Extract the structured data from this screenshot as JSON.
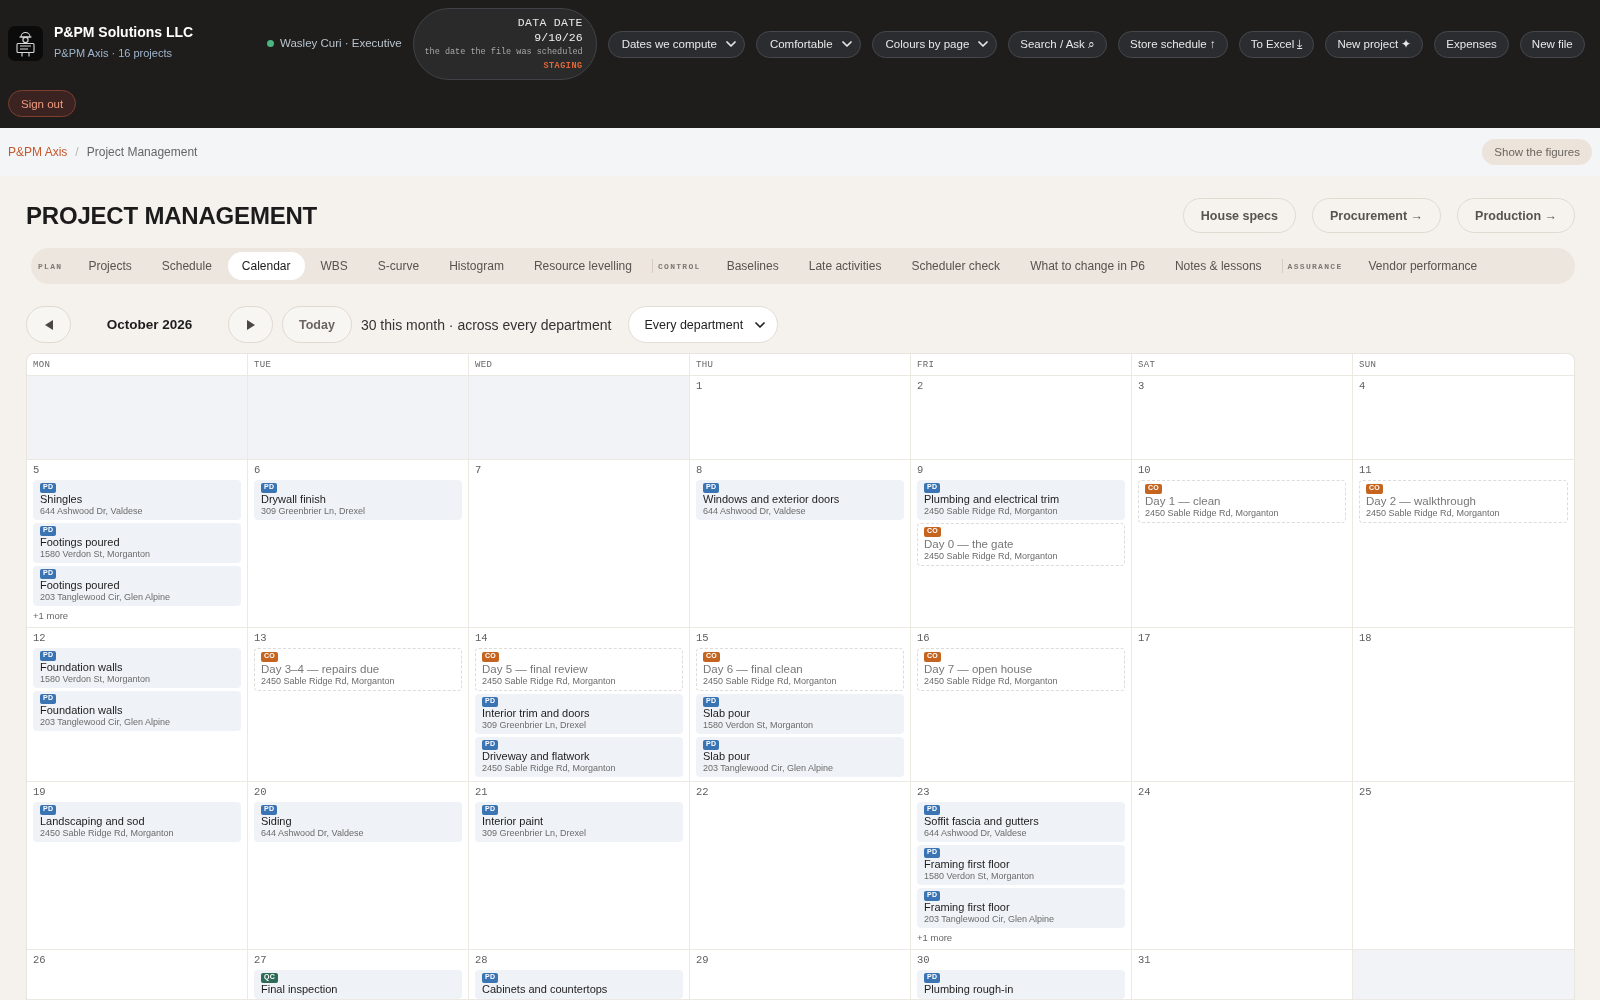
{
  "header": {
    "company": "P&PM Solutions LLC",
    "subtitle": "P&PM Axis · 16 projects",
    "user": {
      "name": "Wasley Curi · Executive",
      "online": true
    },
    "data_date": {
      "label": "DATA DATE",
      "value": "9/10/26",
      "note": "the date the file was scheduled",
      "environment": "STAGING"
    },
    "controls": [
      {
        "kind": "dropdown",
        "label": "Dates we compute"
      },
      {
        "kind": "dropdown",
        "label": "Comfortable"
      },
      {
        "kind": "dropdown",
        "label": "Colours by page"
      },
      {
        "kind": "button",
        "label": "Search / Ask ⌕"
      },
      {
        "kind": "button",
        "label": "Store schedule ↑"
      },
      {
        "kind": "button",
        "label": "To Excel ⤓"
      },
      {
        "kind": "button",
        "label": "New project ✦"
      },
      {
        "kind": "button",
        "label": "Expenses"
      },
      {
        "kind": "button",
        "label": "New file"
      }
    ],
    "sign_out": "Sign out"
  },
  "breadcrumb": {
    "items": [
      {
        "label": "P&PM Axis",
        "kind": "link"
      },
      {
        "label": "Project Management",
        "kind": "current"
      }
    ],
    "separator": "/",
    "action": "Show the figures"
  },
  "page": {
    "title": "PROJECT MANAGEMENT",
    "links": [
      "House specs",
      "Procurement →",
      "Production →"
    ]
  },
  "tab_groups": [
    {
      "label": "PLAN",
      "tabs": [
        {
          "label": "Projects",
          "selected": false
        },
        {
          "label": "Schedule",
          "selected": false
        },
        {
          "label": "Calendar",
          "selected": true
        },
        {
          "label": "WBS",
          "selected": false
        },
        {
          "label": "S-curve",
          "selected": false
        },
        {
          "label": "Histogram",
          "selected": false
        },
        {
          "label": "Resource levelling",
          "selected": false
        }
      ]
    },
    {
      "label": "CONTROL",
      "tabs": [
        {
          "label": "Baselines",
          "selected": false
        },
        {
          "label": "Late activities",
          "selected": false
        },
        {
          "label": "Scheduler check",
          "selected": false
        },
        {
          "label": "What to change in P6",
          "selected": false
        },
        {
          "label": "Notes & lessons",
          "selected": false
        }
      ]
    },
    {
      "label": "ASSURANCE",
      "tabs": [
        {
          "label": "Vendor performance",
          "selected": false
        }
      ]
    }
  ],
  "calendar": {
    "month": "October 2026",
    "today": "Today",
    "summary": "30 this month · across every department",
    "department": "Every department",
    "weekdays": [
      "MON",
      "TUE",
      "WED",
      "THU",
      "FRI",
      "SAT",
      "SUN"
    ],
    "weeks": [
      {
        "days": [
          {
            "in_month": false
          },
          {
            "in_month": false
          },
          {
            "in_month": false
          },
          {
            "in_month": true,
            "day": "1"
          },
          {
            "in_month": true,
            "day": "2"
          },
          {
            "in_month": true,
            "day": "3"
          },
          {
            "in_month": true,
            "day": "4"
          }
        ]
      },
      {
        "days": [
          {
            "in_month": true,
            "day": "5",
            "events": [
              {
                "badge": "PD",
                "color": "#3a74b3",
                "kind": "task",
                "title": "Shingles",
                "address": "644 Ashwood Dr, Valdese"
              },
              {
                "badge": "PD",
                "color": "#3a74b3",
                "kind": "task",
                "title": "Footings poured",
                "address": "1580 Verdon St, Morganton"
              },
              {
                "badge": "PD",
                "color": "#3a74b3",
                "kind": "task",
                "title": "Footings poured",
                "address": "203 Tanglewood Cir, Glen Alpine"
              }
            ],
            "more": "+1 more"
          },
          {
            "in_month": true,
            "day": "6",
            "events": [
              {
                "badge": "PD",
                "color": "#3a74b3",
                "kind": "task",
                "title": "Drywall finish",
                "address": "309 Greenbrier Ln, Drexel"
              }
            ]
          },
          {
            "in_month": true,
            "day": "7"
          },
          {
            "in_month": true,
            "day": "8",
            "events": [
              {
                "badge": "PD",
                "color": "#3a74b3",
                "kind": "task",
                "title": "Windows and exterior doors",
                "address": "644 Ashwood Dr, Valdese"
              }
            ]
          },
          {
            "in_month": true,
            "day": "9",
            "events": [
              {
                "badge": "PD",
                "color": "#3a74b3",
                "kind": "task",
                "title": "Plumbing and electrical trim",
                "address": "2450 Sable Ridge Rd, Morganton"
              },
              {
                "badge": "CO",
                "color": "#c4641f",
                "kind": "milestone",
                "title": "Day 0 — the gate",
                "address": "2450 Sable Ridge Rd, Morganton"
              }
            ]
          },
          {
            "in_month": true,
            "day": "10",
            "events": [
              {
                "badge": "CO",
                "color": "#c4641f",
                "kind": "milestone",
                "title": "Day 1 — clean",
                "address": "2450 Sable Ridge Rd, Morganton"
              }
            ]
          },
          {
            "in_month": true,
            "day": "11",
            "events": [
              {
                "badge": "CO",
                "color": "#c4641f",
                "kind": "milestone",
                "title": "Day 2 — walkthrough",
                "address": "2450 Sable Ridge Rd, Morganton"
              }
            ]
          }
        ]
      },
      {
        "days": [
          {
            "in_month": true,
            "day": "12",
            "events": [
              {
                "badge": "PD",
                "color": "#3a74b3",
                "kind": "task",
                "title": "Foundation walls",
                "address": "1580 Verdon St, Morganton"
              },
              {
                "badge": "PD",
                "color": "#3a74b3",
                "kind": "task",
                "title": "Foundation walls",
                "address": "203 Tanglewood Cir, Glen Alpine"
              }
            ]
          },
          {
            "in_month": true,
            "day": "13",
            "events": [
              {
                "badge": "CO",
                "color": "#c4641f",
                "kind": "milestone",
                "title": "Day 3–4 — repairs due",
                "address": "2450 Sable Ridge Rd, Morganton"
              }
            ]
          },
          {
            "in_month": true,
            "day": "14",
            "events": [
              {
                "badge": "CO",
                "color": "#c4641f",
                "kind": "milestone",
                "title": "Day 5 — final review",
                "address": "2450 Sable Ridge Rd, Morganton"
              },
              {
                "badge": "PD",
                "color": "#3a74b3",
                "kind": "task",
                "title": "Interior trim and doors",
                "address": "309 Greenbrier Ln, Drexel"
              },
              {
                "badge": "PD",
                "color": "#3a74b3",
                "kind": "task",
                "title": "Driveway and flatwork",
                "address": "2450 Sable Ridge Rd, Morganton"
              }
            ]
          },
          {
            "in_month": true,
            "day": "15",
            "events": [
              {
                "badge": "CO",
                "color": "#c4641f",
                "kind": "milestone",
                "title": "Day 6 — final clean",
                "address": "2450 Sable Ridge Rd, Morganton"
              },
              {
                "badge": "PD",
                "color": "#3a74b3",
                "kind": "task",
                "title": "Slab pour",
                "address": "1580 Verdon St, Morganton"
              },
              {
                "badge": "PD",
                "color": "#3a74b3",
                "kind": "task",
                "title": "Slab pour",
                "address": "203 Tanglewood Cir, Glen Alpine"
              }
            ]
          },
          {
            "in_month": true,
            "day": "16",
            "events": [
              {
                "badge": "CO",
                "color": "#c4641f",
                "kind": "milestone",
                "title": "Day 7 — open house",
                "address": "2450 Sable Ridge Rd, Morganton"
              }
            ]
          },
          {
            "in_month": true,
            "day": "17"
          },
          {
            "in_month": true,
            "day": "18"
          }
        ]
      },
      {
        "days": [
          {
            "in_month": true,
            "day": "19",
            "events": [
              {
                "badge": "PD",
                "color": "#3a74b3",
                "kind": "task",
                "title": "Landscaping and sod",
                "address": "2450 Sable Ridge Rd, Morganton"
              }
            ]
          },
          {
            "in_month": true,
            "day": "20",
            "events": [
              {
                "badge": "PD",
                "color": "#3a74b3",
                "kind": "task",
                "title": "Siding",
                "address": "644 Ashwood Dr, Valdese"
              }
            ]
          },
          {
            "in_month": true,
            "day": "21",
            "events": [
              {
                "badge": "PD",
                "color": "#3a74b3",
                "kind": "task",
                "title": "Interior paint",
                "address": "309 Greenbrier Ln, Drexel"
              }
            ]
          },
          {
            "in_month": true,
            "day": "22"
          },
          {
            "in_month": true,
            "day": "23",
            "events": [
              {
                "badge": "PD",
                "color": "#3a74b3",
                "kind": "task",
                "title": "Soffit fascia and gutters",
                "address": "644 Ashwood Dr, Valdese"
              },
              {
                "badge": "PD",
                "color": "#3a74b3",
                "kind": "task",
                "title": "Framing first floor",
                "address": "1580 Verdon St, Morganton"
              },
              {
                "badge": "PD",
                "color": "#3a74b3",
                "kind": "task",
                "title": "Framing first floor",
                "address": "203 Tanglewood Cir, Glen Alpine"
              }
            ],
            "more": "+1 more"
          },
          {
            "in_month": true,
            "day": "24"
          },
          {
            "in_month": true,
            "day": "25"
          }
        ]
      },
      {
        "days": [
          {
            "in_month": true,
            "day": "26"
          },
          {
            "in_month": true,
            "day": "27",
            "events": [
              {
                "badge": "QC",
                "color": "#2e6b57",
                "kind": "task",
                "title": "Final inspection"
              }
            ]
          },
          {
            "in_month": true,
            "day": "28",
            "events": [
              {
                "badge": "PD",
                "color": "#3a74b3",
                "kind": "task",
                "title": "Cabinets and countertops"
              }
            ]
          },
          {
            "in_month": true,
            "day": "29"
          },
          {
            "in_month": true,
            "day": "30",
            "events": [
              {
                "badge": "PD",
                "color": "#3a74b3",
                "kind": "task",
                "title": "Plumbing rough-in"
              }
            ]
          },
          {
            "in_month": true,
            "day": "31"
          },
          {
            "in_month": false
          }
        ]
      }
    ]
  }
}
